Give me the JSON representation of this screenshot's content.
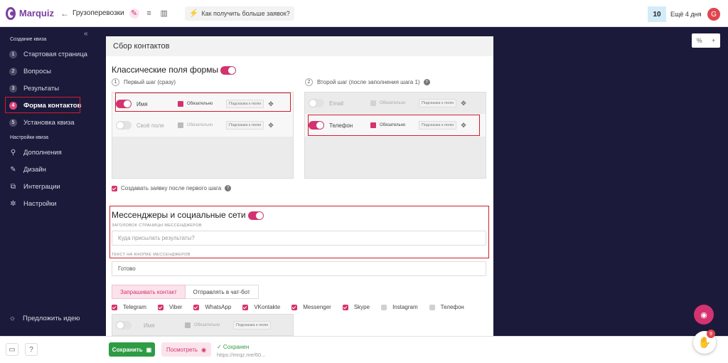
{
  "brand": {
    "name": "Marquiz"
  },
  "header": {
    "quiz_name": "Грузоперевозки",
    "hint": "Как получить больше заявок?",
    "trial_count": "10",
    "trial_label": "Ещё 4 дня",
    "avatar_letter": "G"
  },
  "sidebar": {
    "collapse": "«",
    "section1": "Создание квиза",
    "items": [
      {
        "num": "1",
        "label": "Стартовая страница"
      },
      {
        "num": "2",
        "label": "Вопросы"
      },
      {
        "num": "3",
        "label": "Результаты"
      },
      {
        "num": "4",
        "label": "Форма контактов"
      },
      {
        "num": "5",
        "label": "Установка квиза"
      }
    ],
    "section2": "Настройки квиза",
    "settings": [
      {
        "icon": "puzzle-icon",
        "label": "Дополнения"
      },
      {
        "icon": "brush-icon",
        "label": "Дизайн"
      },
      {
        "icon": "integration-icon",
        "label": "Интеграции"
      },
      {
        "icon": "gear-icon",
        "label": "Настройки"
      }
    ],
    "idea": "Предложить идею"
  },
  "card": {
    "title": "Сбор контактов",
    "classic_title": "Классические поля формы",
    "step1": {
      "num": "1",
      "label": "Первый шаг (сразу)"
    },
    "step2": {
      "num": "2",
      "label": "Второй шаг (после заполнения шага 1)"
    },
    "required_label": "Обязательно",
    "hint_label": "Подсказка к полю",
    "step1_fields": [
      {
        "name": "Имя",
        "enabled": true
      },
      {
        "name": "Своё поле",
        "enabled": false
      }
    ],
    "step2_fields": [
      {
        "name": "Email",
        "enabled": false
      },
      {
        "name": "Телефон",
        "enabled": true
      }
    ],
    "create_order": "Создавать заявку после первого шага",
    "messengers_title": "Мессенджеры и социальные сети",
    "messengers_header_label": "Заголовок страницы мессенджеров",
    "messengers_header_placeholder": "Куда присылать результаты?",
    "button_text_label": "Текст на кнопке мессенджеров",
    "button_text_value": "Готово",
    "mode_request": "Запрашивать контакт",
    "mode_chatbot": "Отправлять в чат-бот",
    "messengers": [
      {
        "name": "Telegram",
        "checked": true
      },
      {
        "name": "Viber",
        "checked": true
      },
      {
        "name": "WhatsApp",
        "checked": true
      },
      {
        "name": "VKontakte",
        "checked": true
      },
      {
        "name": "Messenger",
        "checked": true
      },
      {
        "name": "Skype",
        "checked": true
      },
      {
        "name": "Instagram",
        "checked": false
      },
      {
        "name": "Телефон",
        "checked": false
      }
    ],
    "bottom_field": "Имя"
  },
  "footer": {
    "save": "Сохранить",
    "view": "Посмотреть",
    "saved": "✓ Сохранен",
    "url": "https://mrqz.me/60..."
  },
  "right_ctrl": {
    "percent": "%",
    "plus": "+"
  },
  "wave_badge": "9",
  "colors": {
    "accent": "#d4336f",
    "sidebar_bg": "#1b1a3a",
    "save_green": "#2e9b45",
    "highlight": "#d21c2c"
  }
}
